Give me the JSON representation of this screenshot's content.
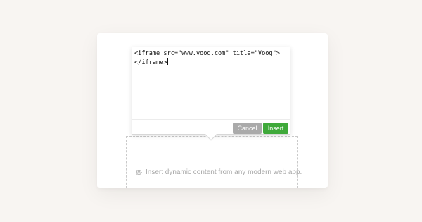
{
  "editor": {
    "code_line_1": "<iframe src=\"www.voog.com\" title=\"Voog\">",
    "code_line_2": "</iframe>"
  },
  "actions": {
    "cancel_label": "Cancel",
    "insert_label": "Insert"
  },
  "placeholder": {
    "text": "Insert dynamic content from any modern web app.",
    "icon": "gear-icon"
  },
  "colors": {
    "background": "#f8f5f2",
    "cancel": "#aaaaaa",
    "insert": "#3fa93a",
    "placeholder_text": "#a7a7a7"
  }
}
